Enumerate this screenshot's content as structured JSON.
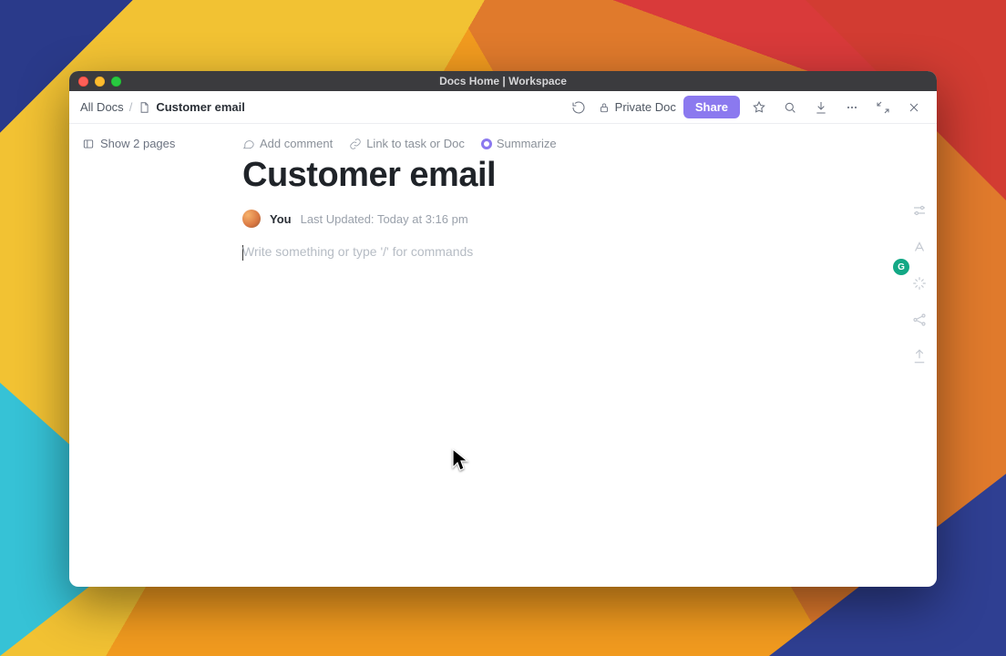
{
  "window": {
    "title": "Docs Home | Workspace"
  },
  "toolbar": {
    "breadcrumb_root": "All Docs",
    "breadcrumb_sep": "/",
    "breadcrumb_current": "Customer email",
    "private_label": "Private Doc",
    "share_label": "Share"
  },
  "left": {
    "show_pages": "Show 2 pages"
  },
  "actions": {
    "add_comment": "Add comment",
    "link_task": "Link to task or Doc",
    "summarize": "Summarize"
  },
  "doc": {
    "title": "Customer email",
    "author": "You",
    "updated_prefix": "Last Updated:",
    "updated_value": "Today at 3:16 pm",
    "placeholder": "Write something or type '/' for commands"
  },
  "badge": {
    "glyph": "G"
  }
}
